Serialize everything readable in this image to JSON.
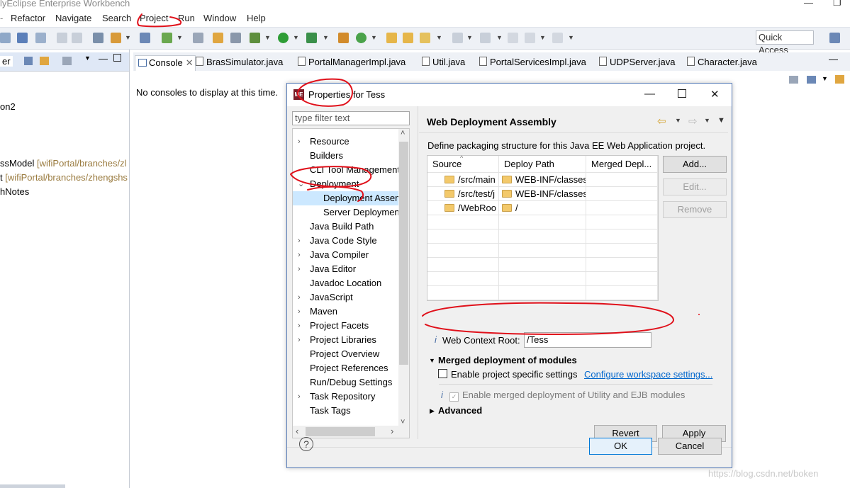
{
  "window": {
    "title": "lyEclipse Enterprise Workbench"
  },
  "menu": [
    "Refactor",
    "Navigate",
    "Search",
    "Project",
    "Run",
    "Window",
    "Help"
  ],
  "toolbar": {
    "quick_access": "Quick Access"
  },
  "left_panel": {
    "tab_label": "er",
    "rows": [
      {
        "text": "on2",
        "suffix": ""
      },
      {
        "text": "ssModel ",
        "suffix": "[wifiPortal/branches/zl"
      },
      {
        "text": "t ",
        "suffix": "[wifiPortal/branches/zhengshs"
      },
      {
        "text": "hNotes",
        "suffix": ""
      }
    ]
  },
  "editor_tabs": [
    "Console",
    "BrasSimulator.java",
    "PortalManagerImpl.java",
    "Util.java",
    "PortalServicesImpl.java",
    "UDPServer.java",
    "Character.java"
  ],
  "console": {
    "message": "No consoles to display at this time."
  },
  "dialog": {
    "title": "Properties for Tess",
    "filter_placeholder": "type filter text",
    "nav": [
      {
        "label": "Resource",
        "expandable": true,
        "level": 0
      },
      {
        "label": "Builders",
        "expandable": false,
        "level": 0
      },
      {
        "label": "CLI Tool Management",
        "expandable": false,
        "level": 0
      },
      {
        "label": "Deployment",
        "expandable": true,
        "expanded": true,
        "level": 0
      },
      {
        "label": "Deployment Assembly",
        "expandable": false,
        "level": 1,
        "selected": true
      },
      {
        "label": "Server Deployment",
        "expandable": false,
        "level": 1
      },
      {
        "label": "Java Build Path",
        "expandable": false,
        "level": 0
      },
      {
        "label": "Java Code Style",
        "expandable": true,
        "level": 0
      },
      {
        "label": "Java Compiler",
        "expandable": true,
        "level": 0
      },
      {
        "label": "Java Editor",
        "expandable": true,
        "level": 0
      },
      {
        "label": "Javadoc Location",
        "expandable": false,
        "level": 0
      },
      {
        "label": "JavaScript",
        "expandable": true,
        "level": 0
      },
      {
        "label": "Maven",
        "expandable": true,
        "level": 0
      },
      {
        "label": "Project Facets",
        "expandable": true,
        "level": 0
      },
      {
        "label": "Project Libraries",
        "expandable": true,
        "level": 0
      },
      {
        "label": "Project Overview",
        "expandable": false,
        "level": 0
      },
      {
        "label": "Project References",
        "expandable": false,
        "level": 0
      },
      {
        "label": "Run/Debug Settings",
        "expandable": false,
        "level": 0
      },
      {
        "label": "Task Repository",
        "expandable": true,
        "level": 0
      },
      {
        "label": "Task Tags",
        "expandable": false,
        "level": 0
      }
    ],
    "page_title": "Web Deployment Assembly",
    "description": "Define packaging structure for this Java EE Web Application project.",
    "table": {
      "columns": [
        "Source",
        "Deploy Path",
        "Merged Depl..."
      ],
      "rows": [
        {
          "source": "/src/main",
          "deploy": "WEB-INF/classes",
          "merged": ""
        },
        {
          "source": "/src/test/j",
          "deploy": "WEB-INF/classes",
          "merged": ""
        },
        {
          "source": "/WebRoo",
          "deploy": "/",
          "merged": ""
        }
      ]
    },
    "buttons": {
      "add": "Add...",
      "edit": "Edit...",
      "remove": "Remove",
      "revert": "Revert",
      "apply": "Apply",
      "ok": "OK",
      "cancel": "Cancel"
    },
    "context_root_label": "Web Context Root:",
    "context_root_value": "/Tess",
    "merged_section": "Merged deployment of modules",
    "project_specific": "Enable project specific settings",
    "configure_link": "Configure workspace settings...",
    "merged_utility": "Enable merged deployment of Utility and EJB modules",
    "advanced": "Advanced"
  },
  "watermark": "https://blog.csdn.net/boken",
  "colors": {
    "accent": "#0078d7",
    "annotation": "#e0101a",
    "selection": "#cce8ff"
  }
}
